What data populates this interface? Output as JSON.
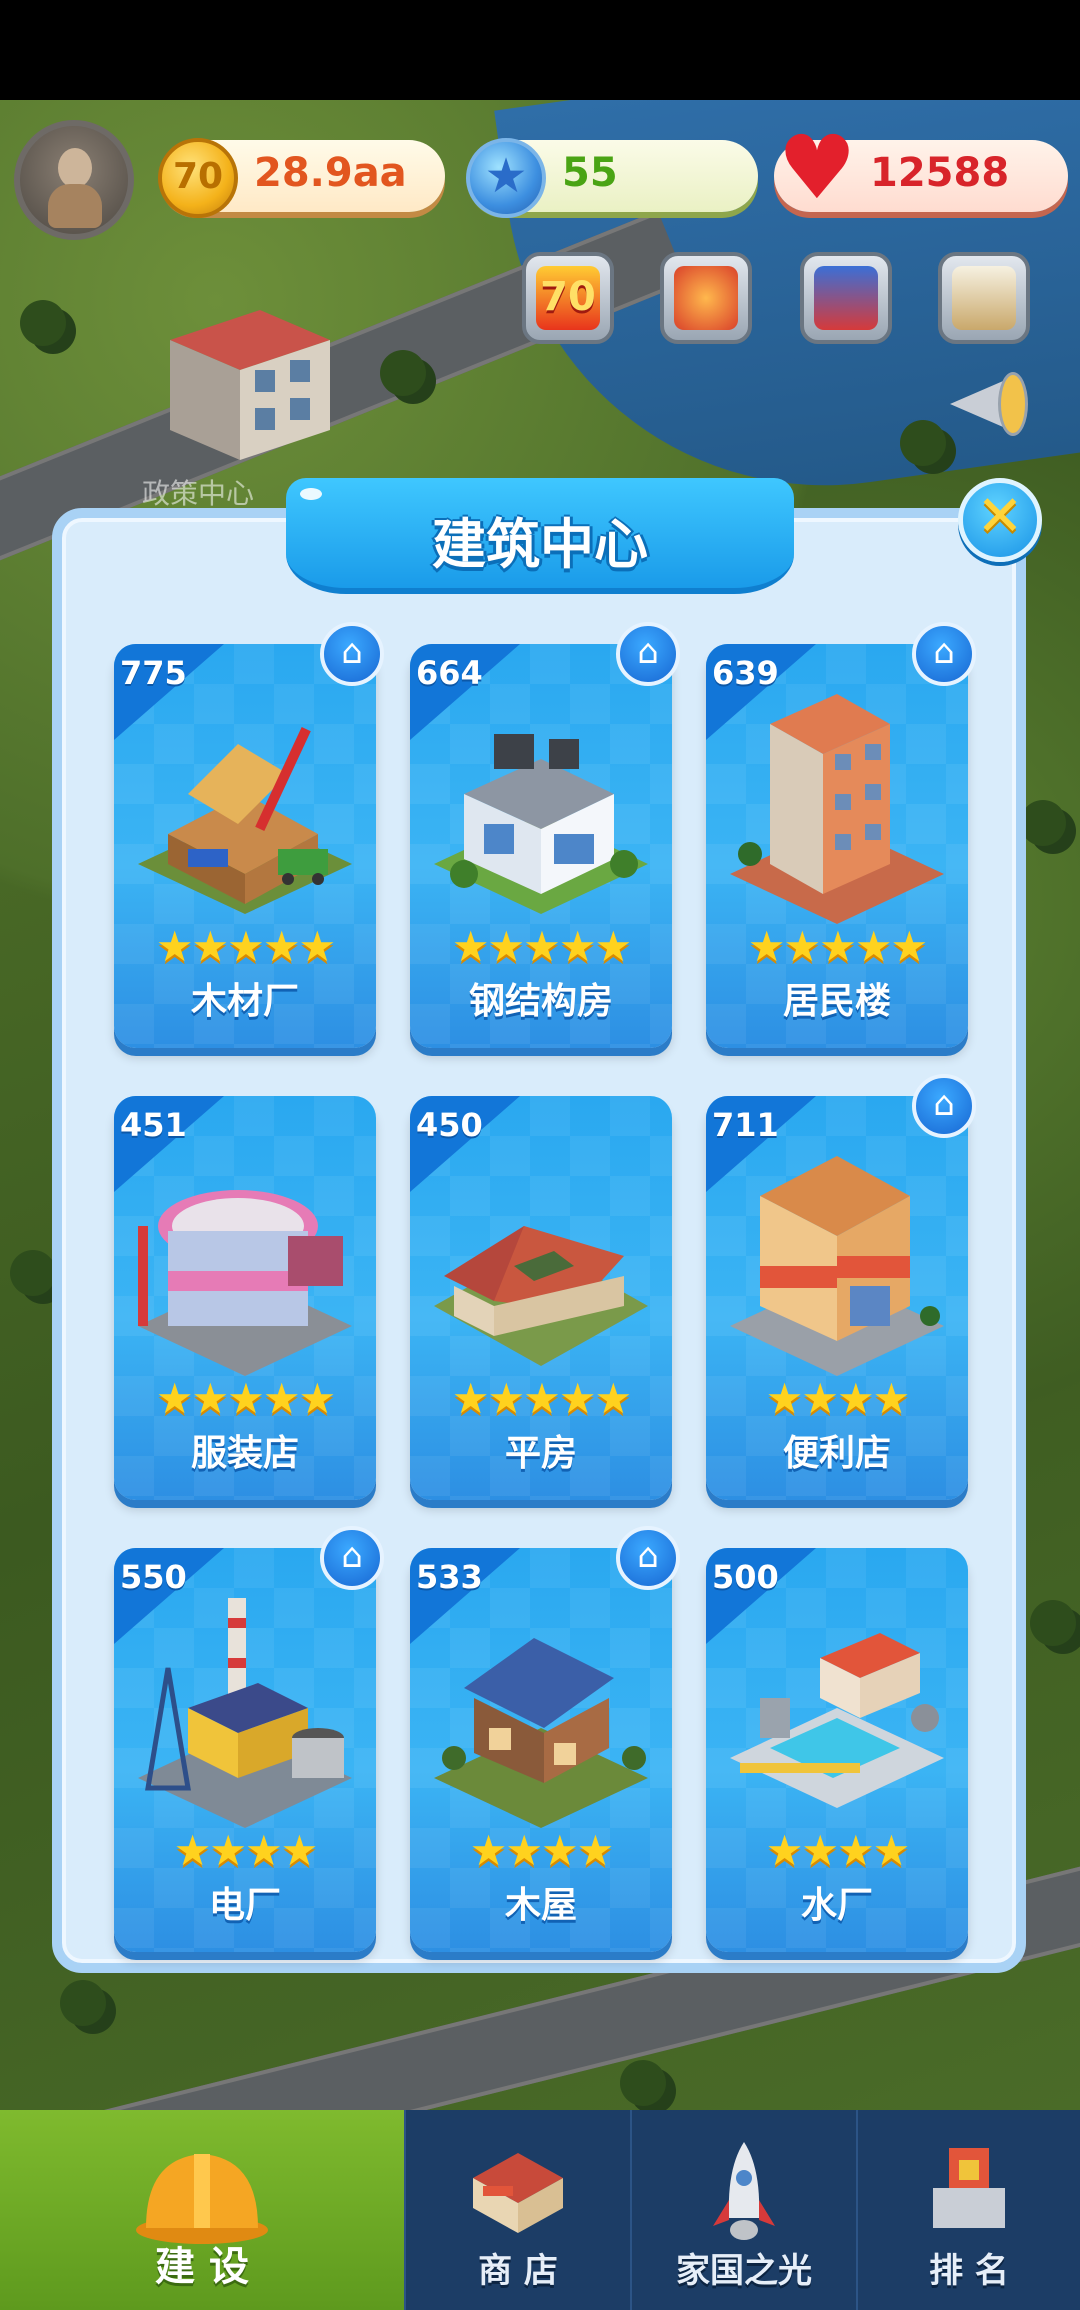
{
  "hud": {
    "coins": {
      "icon": "coin-icon",
      "value": "28.9aa",
      "badge": "70",
      "color": "#e2561f"
    },
    "stars": {
      "icon": "star-icon",
      "value": "55",
      "color": "#4aa414"
    },
    "hearts": {
      "icon": "heart-icon",
      "value": "12588",
      "color": "#d8242a"
    }
  },
  "map": {
    "label": "政策中心"
  },
  "dialog": {
    "title": "建筑中心",
    "buildings": [
      {
        "count": "775",
        "name": "木材厂",
        "stars": 5,
        "stars_text": "★★★★★",
        "home": true
      },
      {
        "count": "664",
        "name": "钢结构房",
        "stars": 5,
        "stars_text": "★★★★★",
        "home": true
      },
      {
        "count": "639",
        "name": "居民楼",
        "stars": 5,
        "stars_text": "★★★★★",
        "home": true
      },
      {
        "count": "451",
        "name": "服装店",
        "stars": 5,
        "stars_text": "★★★★★",
        "home": false
      },
      {
        "count": "450",
        "name": "平房",
        "stars": 5,
        "stars_text": "★★★★★",
        "home": false
      },
      {
        "count": "711",
        "name": "便利店",
        "stars": 4,
        "stars_text": "★★★★",
        "home": true
      },
      {
        "count": "550",
        "name": "电厂",
        "stars": 4,
        "stars_text": "★★★★",
        "home": true
      },
      {
        "count": "533",
        "name": "木屋",
        "stars": 4,
        "stars_text": "★★★★",
        "home": true
      },
      {
        "count": "500",
        "name": "水厂",
        "stars": 4,
        "stars_text": "★★★★",
        "home": false
      }
    ]
  },
  "nav": {
    "items": [
      {
        "label": "建 设",
        "icon": "hard-hat-icon",
        "active": true
      },
      {
        "label": "商 店",
        "icon": "shop-icon",
        "active": false
      },
      {
        "label": "家国之光",
        "icon": "rocket-icon",
        "active": false
      },
      {
        "label": "排 名",
        "icon": "ranking-icon",
        "active": false
      }
    ]
  }
}
